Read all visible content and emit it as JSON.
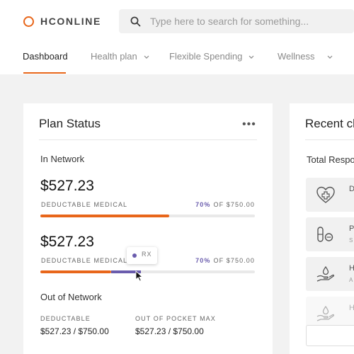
{
  "brand": {
    "name": "HCONLINE",
    "accent": "#e8661a"
  },
  "search": {
    "placeholder": "Type here to search for something..."
  },
  "nav": {
    "items": [
      {
        "label": "Dashboard",
        "active": true
      },
      {
        "label": "Health plan",
        "dropdown": true
      },
      {
        "label": "Flexible Spending",
        "dropdown": true
      },
      {
        "label": "Wellness",
        "dropdown": true
      }
    ]
  },
  "plan_status": {
    "title": "Plan Status",
    "more_icon": "more-horizontal-icon",
    "in_network": {
      "label": "In Network",
      "bars": [
        {
          "amount": "$527.23",
          "category": "DEDUCTABLE MEDICAL",
          "percent": "70%",
          "of_total": "OF $750.00",
          "medical_fill": 0.6
        },
        {
          "amount": "$527.23",
          "category": "DEDUCTABLE MEDICAL",
          "percent": "70%",
          "of_total": "OF $750.00",
          "medical_fill": 0.33,
          "rx_fill": 0.14
        }
      ],
      "tooltip_label": "RX",
      "rx_color": "#6a5cad"
    },
    "out_of_network": {
      "label": "Out of Network",
      "deductable_label": "DEDUCTABLE",
      "deductable_value": "$527.23 / $750.00",
      "oop_label": "OUT OF POCKET MAX",
      "oop_value": "$527.23 / $750.00"
    }
  },
  "recent": {
    "title": "Recent cl",
    "subtitle": "Total Respo",
    "tiles": [
      {
        "icon": "heart-plus-icon",
        "letter": "D",
        "sub": ""
      },
      {
        "icon": "pills-icon",
        "letter": "P",
        "sub": "S"
      },
      {
        "icon": "hand-drop-icon",
        "letter": "H",
        "sub": "A"
      },
      {
        "icon": "hand-drop-icon",
        "letter": "H",
        "sub": ""
      }
    ]
  }
}
